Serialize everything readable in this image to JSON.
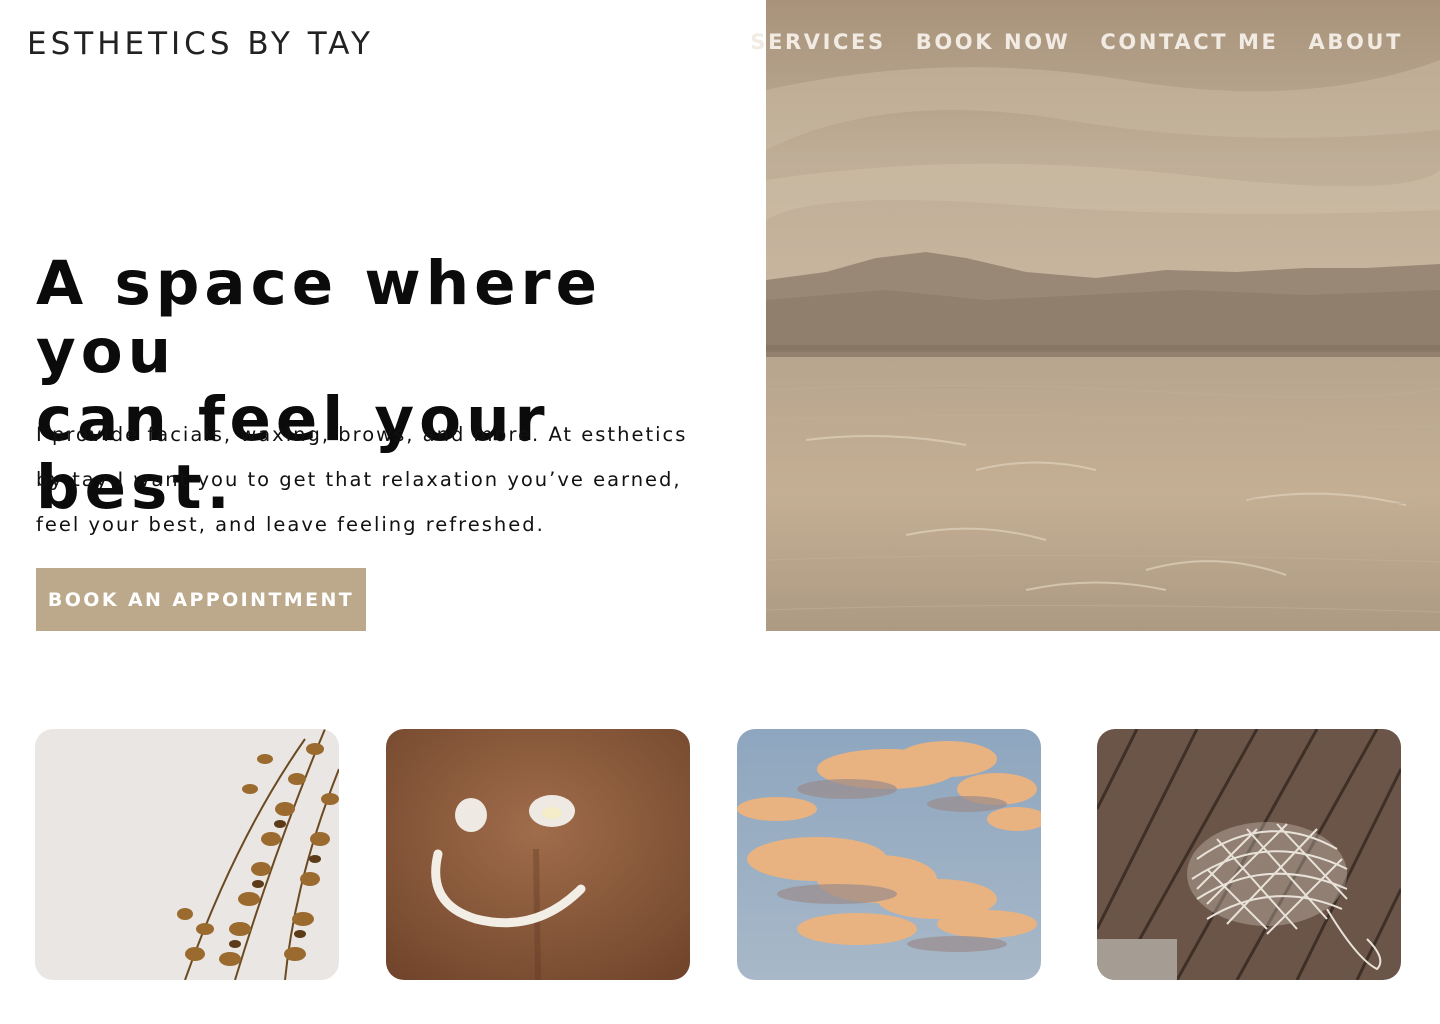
{
  "brand": {
    "name": "ESTHETICS BY TAY"
  },
  "nav": {
    "items": [
      {
        "label": "SERVICES"
      },
      {
        "label": "BOOK NOW"
      },
      {
        "label": "CONTACT ME"
      },
      {
        "label": "ABOUT"
      }
    ]
  },
  "hero": {
    "headline_line1": "A space where you",
    "headline_line2": "can feel your best.",
    "intro_line1": "I provide facials, waxing, brows, and more. At esthetics",
    "intro_line2": "by tay I want you to get that relaxation you’ve earned,",
    "intro_line3": "feel your best, and leave feeling refreshed.",
    "cta_label": "BOOK AN APPOINTMENT"
  },
  "colors": {
    "accent": "#bca88a",
    "nav_text": "#f1ebe3",
    "heading": "#0b0b0b"
  },
  "gallery": [
    {
      "icon": "eucalyptus-photo"
    },
    {
      "icon": "smiley-lotion-photo"
    },
    {
      "icon": "sunset-clouds-photo"
    },
    {
      "icon": "mesh-bag-photo"
    }
  ]
}
